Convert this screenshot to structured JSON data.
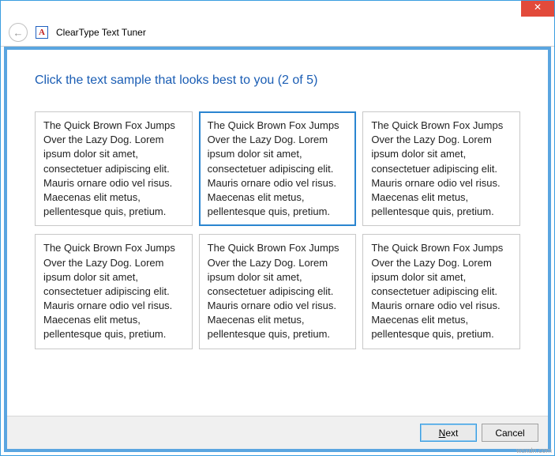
{
  "window": {
    "title": "ClearType Text Tuner",
    "close_glyph": "✕"
  },
  "header": {
    "back_glyph": "←",
    "icon_letter": "A",
    "title": "ClearType Text Tuner"
  },
  "content": {
    "instruction": "Click the text sample that looks best to you (2 of 5)",
    "sample_text": "The Quick Brown Fox Jumps Over the Lazy Dog. Lorem ipsum dolor sit amet, consectetuer adipiscing elit. Mauris ornare odio vel risus. Maecenas elit metus, pellentesque quis, pretium.",
    "selected_index": 1,
    "samples": [
      {
        "text": "The Quick Brown Fox Jumps Over the Lazy Dog. Lorem ipsum dolor sit amet, consectetuer adipiscing elit. Mauris ornare odio vel risus. Maecenas elit metus, pellentesque quis, pretium."
      },
      {
        "text": "The Quick Brown Fox Jumps Over the Lazy Dog. Lorem ipsum dolor sit amet, consectetuer adipiscing elit. Mauris ornare odio vel risus. Maecenas elit metus, pellentesque quis, pretium."
      },
      {
        "text": "The Quick Brown Fox Jumps Over the Lazy Dog. Lorem ipsum dolor sit amet, consectetuer adipiscing elit. Mauris ornare odio vel risus. Maecenas elit metus, pellentesque quis, pretium."
      },
      {
        "text": "The Quick Brown Fox Jumps Over the Lazy Dog. Lorem ipsum dolor sit amet, consectetuer adipiscing elit. Mauris ornare odio vel risus. Maecenas elit metus, pellentesque quis, pretium."
      },
      {
        "text": "The Quick Brown Fox Jumps Over the Lazy Dog. Lorem ipsum dolor sit amet, consectetuer adipiscing elit. Mauris ornare odio vel risus. Maecenas elit metus, pellentesque quis, pretium."
      },
      {
        "text": "The Quick Brown Fox Jumps Over the Lazy Dog. Lorem ipsum dolor sit amet, consectetuer adipiscing elit. Mauris ornare odio vel risus. Maecenas elit metus, pellentesque quis, pretium."
      }
    ]
  },
  "footer": {
    "next_label": "Next",
    "next_accel": "N",
    "cancel_label": "Cancel"
  },
  "watermark": "wsxdn.com"
}
